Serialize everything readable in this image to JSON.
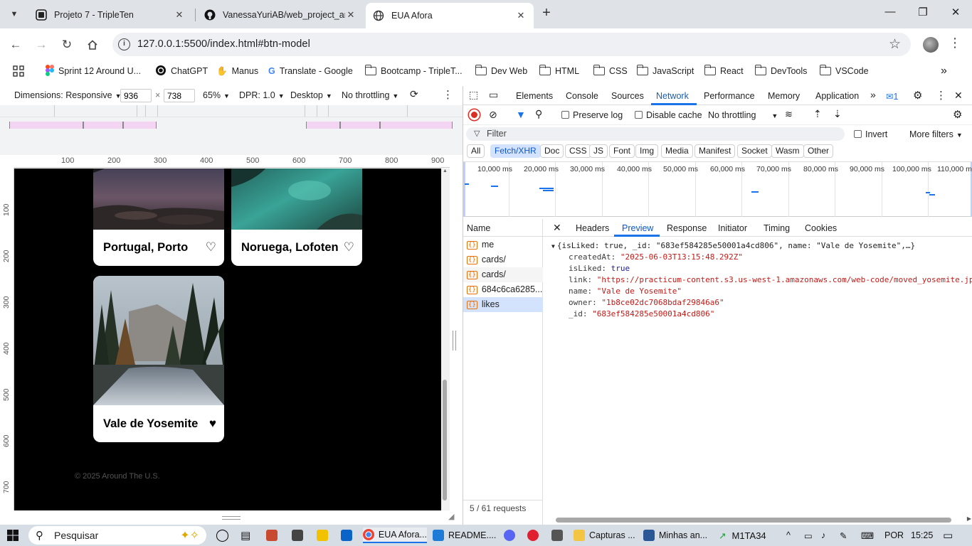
{
  "browser": {
    "tabs": [
      {
        "title": "Projeto 7 - TripleTen",
        "icon": "tripleten-icon"
      },
      {
        "title": "VanessaYuriAB/web_project_arc",
        "icon": "github-icon"
      },
      {
        "title": "EUA Afora",
        "icon": "globe-icon"
      }
    ],
    "url": "127.0.0.1:5500/index.html#btn-model",
    "bookmarks": [
      "Sprint 12 Around U...",
      "ChatGPT",
      "Manus",
      "Translate - Google",
      "Bootcamp - TripleT...",
      "Dev Web",
      "HTML",
      "CSS",
      "JavaScript",
      "React",
      "DevTools",
      "VSCode"
    ]
  },
  "device_toolbar": {
    "dimensions_label": "Dimensions: Responsive",
    "width": "936",
    "height": "738",
    "zoom": "65%",
    "dpr": "DPR: 1.0",
    "device_type": "Desktop",
    "throttling": "No throttling"
  },
  "ruler": {
    "h_labels": [
      "100",
      "200",
      "300",
      "400",
      "500",
      "600",
      "700",
      "800",
      "900"
    ],
    "v_labels": [
      "100",
      "200",
      "300",
      "400",
      "500",
      "600",
      "700"
    ]
  },
  "page": {
    "cards": [
      {
        "title": "Portugal, Porto",
        "liked": false
      },
      {
        "title": "Noruega, Lofoten",
        "liked": false
      },
      {
        "title": "Vale de Yosemite",
        "liked": true
      }
    ],
    "footer": "© 2025 Around The U.S."
  },
  "devtools": {
    "tabs": [
      "Elements",
      "Console",
      "Sources",
      "Network",
      "Performance",
      "Memory",
      "Application"
    ],
    "active_tab": "Network",
    "issues_count": "1",
    "toolbar": {
      "preserve_log": "Preserve log",
      "disable_cache": "Disable cache",
      "throttling": "No throttling"
    },
    "filter": {
      "placeholder": "Filter",
      "invert": "Invert",
      "more_filters": "More filters"
    },
    "type_filters": [
      "All",
      "Fetch/XHR",
      "Doc",
      "CSS",
      "JS",
      "Font",
      "Img",
      "Media",
      "Manifest",
      "Socket",
      "Wasm",
      "Other"
    ],
    "active_type": "Fetch/XHR",
    "timeline_labels": [
      "10,000 ms",
      "20,000 ms",
      "30,000 ms",
      "40,000 ms",
      "50,000 ms",
      "60,000 ms",
      "70,000 ms",
      "80,000 ms",
      "90,000 ms",
      "100,000 ms",
      "110,000 m"
    ],
    "requests_header": "Name",
    "requests": [
      "me",
      "cards/",
      "cards/",
      "684c6ca6285...",
      "likes"
    ],
    "selected_request": "likes",
    "requests_summary": "5 / 61 requests",
    "detail_tabs": [
      "Headers",
      "Preview",
      "Response",
      "Initiator",
      "Timing",
      "Cookies"
    ],
    "active_detail_tab": "Preview",
    "preview": {
      "summary": "{isLiked: true, _id: \"683ef584285e50001a4cd806\", name: \"Vale de Yosemite\",…}",
      "fields": [
        {
          "key": "createdAt",
          "value": "\"2025-06-03T13:15:48.292Z\"",
          "kind": "string"
        },
        {
          "key": "isLiked",
          "value": "true",
          "kind": "bool"
        },
        {
          "key": "link",
          "value": "\"https://practicum-content.s3.us-west-1.amazonaws.com/web-code/moved_yosemite.jp",
          "kind": "string"
        },
        {
          "key": "name",
          "value": "\"Vale de Yosemite\"",
          "kind": "string"
        },
        {
          "key": "owner",
          "value": "\"1b8ce02dc7068bdaf29846a6\"",
          "kind": "string"
        },
        {
          "key": "_id",
          "value": "\"683ef584285e50001a4cd806\"",
          "kind": "string"
        }
      ]
    }
  },
  "taskbar": {
    "search_placeholder": "Pesquisar",
    "apps": [
      {
        "label": "EUA Afora..."
      },
      {
        "label": "README...."
      },
      {
        "label": "Capturas ..."
      },
      {
        "label": "Minhas an..."
      }
    ],
    "stock": "M1TA34",
    "language": "POR",
    "time": "15:25"
  }
}
